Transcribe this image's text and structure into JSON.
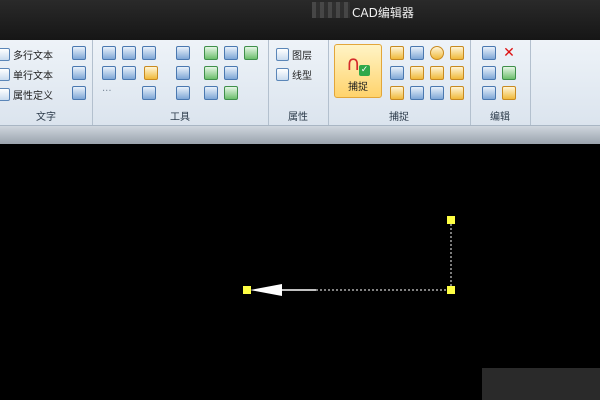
{
  "window": {
    "title": "CAD编辑器"
  },
  "ribbon": {
    "text_group": {
      "label": "文字",
      "buttons": [
        "多行文本",
        "单行文本",
        "属性定义"
      ]
    },
    "tools_group": {
      "label": "工具"
    },
    "props_group": {
      "label": "属性",
      "buttons": [
        "图层",
        "线型"
      ]
    },
    "snap_group": {
      "label": "捕捉",
      "button": "捕捉"
    },
    "edit_group": {
      "label": "编辑"
    }
  },
  "colors": {
    "accent": "#ffd36c",
    "grip": "#ffff44",
    "canvas": "#000000"
  }
}
